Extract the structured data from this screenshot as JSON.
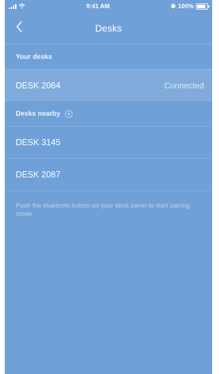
{
  "status_bar": {
    "time": "9:41 AM",
    "battery": "100%"
  },
  "nav": {
    "title": "Desks"
  },
  "your_desks": {
    "header": "Your desks",
    "items": [
      {
        "name": "DESK 2064",
        "status": "Connected"
      }
    ]
  },
  "nearby": {
    "header": "Desks nearby",
    "items": [
      {
        "name": "DESK 3145"
      },
      {
        "name": "DESK 2087"
      }
    ]
  },
  "hint": "Push the bluetooth button on your desk panel to start pairing mode."
}
